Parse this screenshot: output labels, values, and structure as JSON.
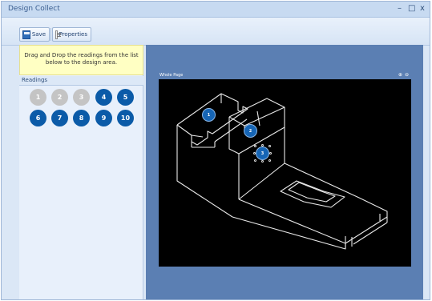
{
  "window": {
    "title": "Design Collect",
    "controls": {
      "minimize": "–",
      "maximize": "□",
      "close": "x"
    }
  },
  "toolbar": {
    "save_label": "Save",
    "properties_label": "Properties"
  },
  "left_panel": {
    "instructions": "Drag and Drop the readings from the list below to the design area.",
    "readings_header": "Readings",
    "readings": [
      {
        "label": "1",
        "state": "placed"
      },
      {
        "label": "2",
        "state": "placed"
      },
      {
        "label": "3",
        "state": "placed"
      },
      {
        "label": "4",
        "state": "available"
      },
      {
        "label": "5",
        "state": "available"
      },
      {
        "label": "6",
        "state": "available"
      },
      {
        "label": "7",
        "state": "available"
      },
      {
        "label": "8",
        "state": "available"
      },
      {
        "label": "9",
        "state": "available"
      },
      {
        "label": "10",
        "state": "available"
      }
    ]
  },
  "design_area": {
    "page_label": "Whole Page",
    "zoom_in_icon": "⊕",
    "zoom_out_icon": "⊖",
    "placed_markers": [
      {
        "label": "1"
      },
      {
        "label": "2"
      },
      {
        "label": "3",
        "selected": true
      }
    ]
  },
  "colors": {
    "marker_blue": "#0b5ba8",
    "marker_used": "#c4c4c4",
    "design_bg": "#5b7fb3",
    "canvas_bg": "#000000",
    "instructions_bg": "#ffffc3"
  }
}
